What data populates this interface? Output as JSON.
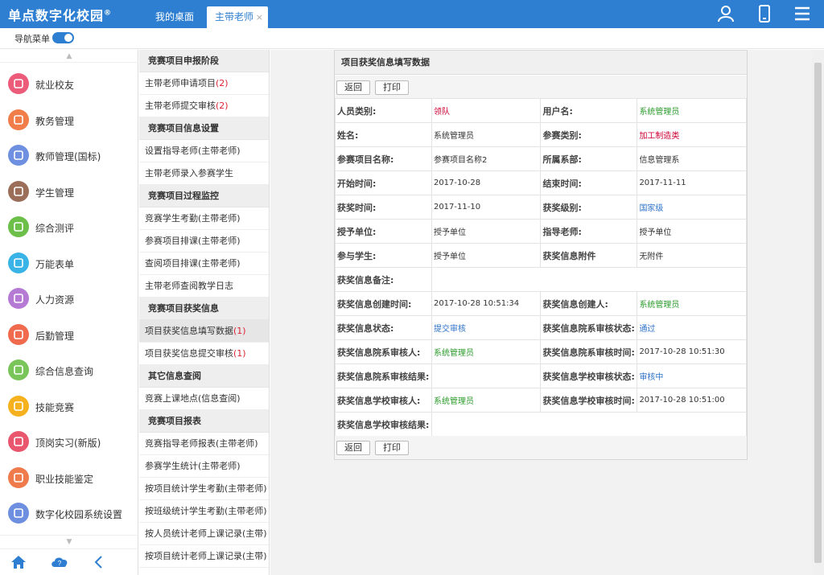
{
  "app": {
    "title": "单点数字化校园",
    "reg": "®"
  },
  "tabs": [
    {
      "label": "我的桌面"
    },
    {
      "label": "主带老师",
      "close": "×"
    }
  ],
  "subbar": {
    "nav_label": "导航菜单"
  },
  "icons": {
    "user": "user-icon",
    "mobile": "mobile-icon",
    "menu": "menu-icon"
  },
  "sidebar": {
    "items": [
      {
        "label": "就业校友",
        "color": "#ec5b7a"
      },
      {
        "label": "教务管理",
        "color": "#f07d4a"
      },
      {
        "label": "教师管理(国标)",
        "color": "#6f8fe0"
      },
      {
        "label": "学生管理",
        "color": "#9b6e5a"
      },
      {
        "label": "综合测评",
        "color": "#6cc04a"
      },
      {
        "label": "万能表单",
        "color": "#3ab4e6"
      },
      {
        "label": "人力资源",
        "color": "#b57ad4"
      },
      {
        "label": "后勤管理",
        "color": "#f06a4d"
      },
      {
        "label": "综合信息查询",
        "color": "#7ac55a"
      },
      {
        "label": "技能竞赛",
        "color": "#f5b11e"
      },
      {
        "label": "顶岗实习(新版)",
        "color": "#e8576e"
      },
      {
        "label": "职业技能鉴定",
        "color": "#ef7a4c"
      },
      {
        "label": "数字化校园系统设置",
        "color": "#6e8fe0"
      }
    ]
  },
  "menu": [
    {
      "type": "head",
      "label": "竞赛项目申报阶段"
    },
    {
      "type": "item",
      "label": "主带老师申请项目",
      "count": "(2)"
    },
    {
      "type": "item",
      "label": "主带老师提交审核",
      "count": "(2)"
    },
    {
      "type": "head",
      "label": "竞赛项目信息设置"
    },
    {
      "type": "item",
      "label": "设置指导老师(主带老师)"
    },
    {
      "type": "item",
      "label": "主带老师录入参赛学生"
    },
    {
      "type": "head",
      "label": "竞赛项目过程监控"
    },
    {
      "type": "item",
      "label": "竞赛学生考勤(主带老师)"
    },
    {
      "type": "item",
      "label": "参赛项目排课(主带老师)"
    },
    {
      "type": "item",
      "label": "查阅项目排课(主带老师)"
    },
    {
      "type": "item",
      "label": "主带老师查阅教学日志"
    },
    {
      "type": "head",
      "label": "竞赛项目获奖信息"
    },
    {
      "type": "item",
      "label": "项目获奖信息填写数据",
      "count": "(1)",
      "active": true
    },
    {
      "type": "item",
      "label": "项目获奖信息提交审核",
      "count": "(1)"
    },
    {
      "type": "head",
      "label": "其它信息查阅"
    },
    {
      "type": "item",
      "label": "竞赛上课地点(信息查阅)"
    },
    {
      "type": "head",
      "label": "竞赛项目报表"
    },
    {
      "type": "item",
      "label": "竞赛指导老师报表(主带老师)"
    },
    {
      "type": "item",
      "label": "参赛学生统计(主带老师)"
    },
    {
      "type": "item",
      "label": "按项目统计学生考勤(主带老师)"
    },
    {
      "type": "item",
      "label": "按班级统计学生考勤(主带老师)"
    },
    {
      "type": "item",
      "label": "按人员统计老师上课记录(主带)"
    },
    {
      "type": "item",
      "label": "按项目统计老师上课记录(主带)"
    }
  ],
  "panel": {
    "title": "项目获奖信息填写数据",
    "back": "返回",
    "print": "打印",
    "rows": [
      [
        {
          "l": "人员类别:",
          "v": "领队",
          "c": "red"
        },
        {
          "l": "用户名:",
          "v": "系统管理员",
          "c": "green"
        }
      ],
      [
        {
          "l": "姓名:",
          "v": "系统管理员"
        },
        {
          "l": "参赛类别:",
          "v": "加工制造类",
          "c": "red"
        }
      ],
      [
        {
          "l": "参赛项目名称:",
          "v": "参赛项目名称2"
        },
        {
          "l": "所属系部:",
          "v": "信息管理系"
        }
      ],
      [
        {
          "l": "开始时间:",
          "v": "2017-10-28"
        },
        {
          "l": "结束时间:",
          "v": "2017-11-11"
        }
      ],
      [
        {
          "l": "获奖时间:",
          "v": "2017-11-10"
        },
        {
          "l": "获奖级别:",
          "v": "国家级",
          "c": "blue"
        }
      ],
      [
        {
          "l": "授予单位:",
          "v": "授予单位"
        },
        {
          "l": "指导老师:",
          "v": "授予单位"
        }
      ],
      [
        {
          "l": "参与学生:",
          "v": "授予单位"
        },
        {
          "l": "获奖信息附件",
          "v": "无附件"
        }
      ],
      [
        {
          "l": "获奖信息备注:",
          "v": "",
          "span": true
        }
      ],
      [
        {
          "l": "获奖信息创建时间:",
          "v": "2017-10-28 10:51:34"
        },
        {
          "l": "获奖信息创建人:",
          "v": "系统管理员",
          "c": "green"
        }
      ],
      [
        {
          "l": "获奖信息状态:",
          "v": "提交审核",
          "c": "blue"
        },
        {
          "l": "获奖信息院系审核状态:",
          "v": "通过",
          "c": "blue"
        }
      ],
      [
        {
          "l": "获奖信息院系审核人:",
          "v": "系统管理员",
          "c": "green"
        },
        {
          "l": "获奖信息院系审核时间:",
          "v": "2017-10-28 10:51:30"
        }
      ],
      [
        {
          "l": "获奖信息院系审核结果:",
          "v": ""
        },
        {
          "l": "获奖信息学校审核状态:",
          "v": "审核中",
          "c": "blue"
        }
      ],
      [
        {
          "l": "获奖信息学校审核人:",
          "v": "系统管理员",
          "c": "green"
        },
        {
          "l": "获奖信息学校审核时间:",
          "v": "2017-10-28 10:51:00"
        }
      ],
      [
        {
          "l": "获奖信息学校审核结果:",
          "v": "",
          "span": true
        }
      ]
    ]
  }
}
